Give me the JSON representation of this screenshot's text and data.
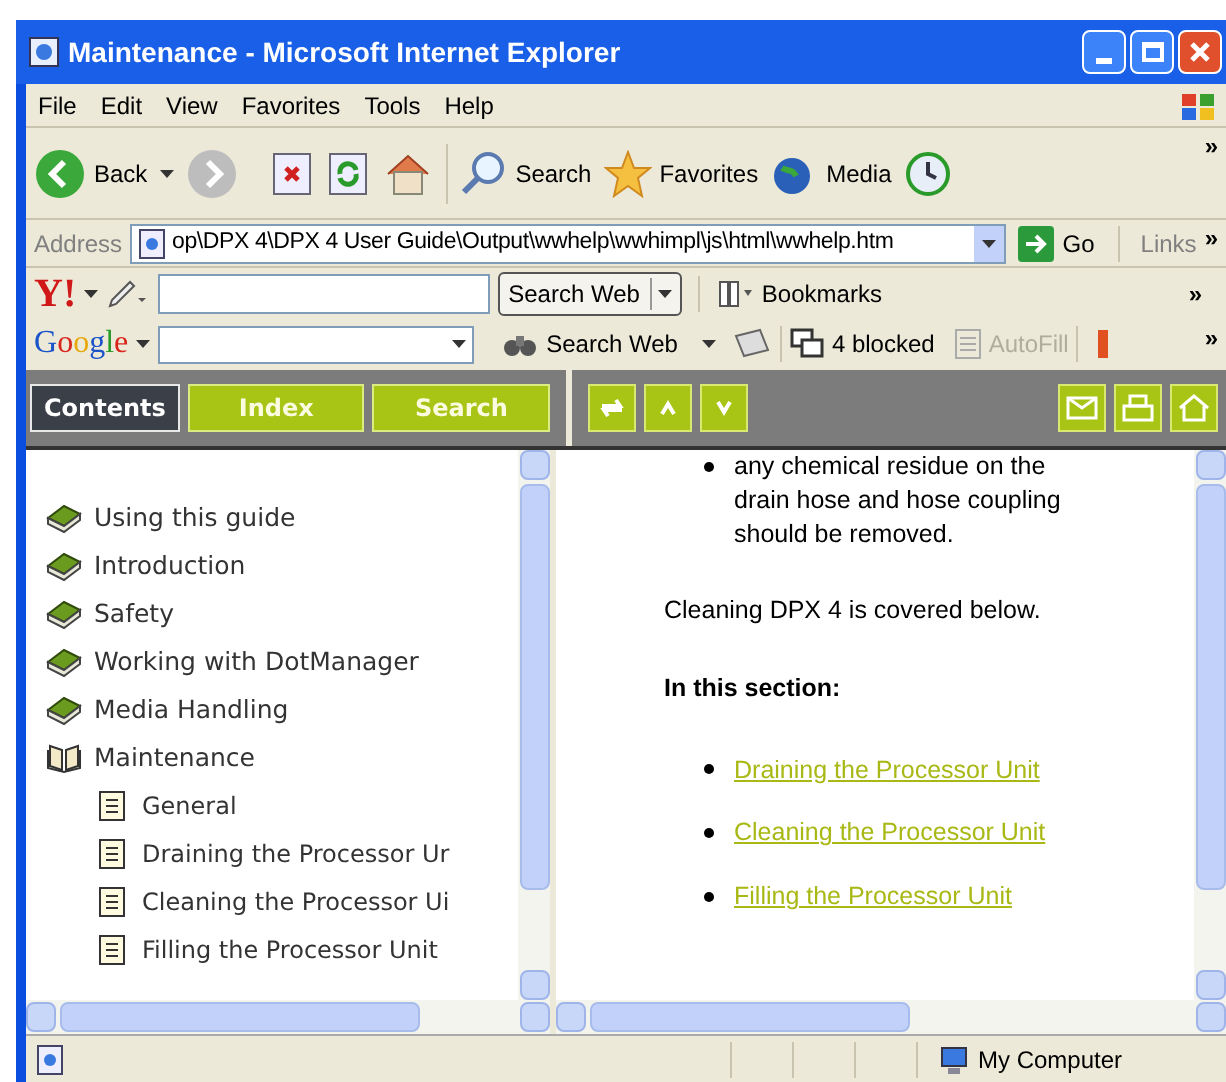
{
  "window": {
    "title": "Maintenance - Microsoft Internet Explorer"
  },
  "menu": [
    "File",
    "Edit",
    "View",
    "Favorites",
    "Tools",
    "Help"
  ],
  "toolbar": {
    "back": "Back",
    "search": "Search",
    "favorites": "Favorites",
    "media": "Media",
    "more": "»"
  },
  "address": {
    "label": "Address",
    "value": "op\\DPX 4\\DPX 4 User Guide\\Output\\wwhelp\\wwhimpl\\js\\html\\wwhelp.htm",
    "go": "Go",
    "links": "Links",
    "more": "»"
  },
  "yahoo": {
    "logo": "Y!",
    "search_button": "Search Web",
    "bookmarks": "Bookmarks",
    "more": "»"
  },
  "google": {
    "logo": "Google",
    "search_button": "Search Web",
    "blocked": "4 blocked",
    "autofill": "AutoFill",
    "autofill_disabled": true,
    "more": "»"
  },
  "help_tabs": [
    {
      "label": "Contents",
      "selected": true
    },
    {
      "label": "Index",
      "selected": false
    },
    {
      "label": "Search",
      "selected": false
    }
  ],
  "toc": [
    {
      "kind": "book",
      "label": "Using this guide",
      "expanded": false
    },
    {
      "kind": "book",
      "label": "Introduction",
      "expanded": false
    },
    {
      "kind": "book",
      "label": "Safety",
      "expanded": false
    },
    {
      "kind": "book",
      "label": "Working with DotManager",
      "expanded": false
    },
    {
      "kind": "book",
      "label": "Media Handling",
      "expanded": false
    },
    {
      "kind": "book",
      "label": "Maintenance",
      "expanded": true,
      "children": [
        {
          "kind": "page",
          "label": "General"
        },
        {
          "kind": "page",
          "label": "Draining the Processor Ur"
        },
        {
          "kind": "page",
          "label": "Cleaning the Processor Ui"
        },
        {
          "kind": "page",
          "label": "Filling the Processor Unit"
        }
      ]
    }
  ],
  "content": {
    "bullet": "any chemical residue on the drain hose and hose coupling should be removed.",
    "paragraph": "Cleaning DPX 4 is covered below.",
    "heading": "In this section:",
    "links": [
      "Draining the Processor Unit",
      "Cleaning the Processor Unit",
      "Filling the Processor Unit"
    ]
  },
  "status_bar": {
    "zone": "My Computer"
  }
}
